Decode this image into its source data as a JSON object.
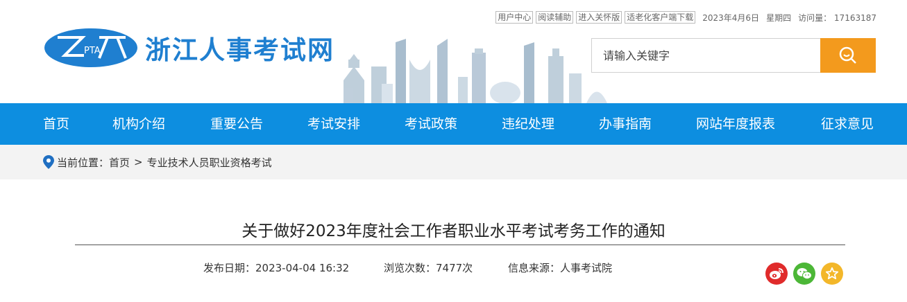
{
  "topbar": {
    "user_center": "用户中心",
    "reading_aid": "阅读辅助",
    "care_mode": "进入关怀版",
    "elderly_client": "适老化客户端下载",
    "date": "2023年4月6日",
    "weekday": "星期四",
    "visits_label": "访问量：",
    "visits_value": "17163187"
  },
  "logo": {
    "mark_text": "PTA",
    "site_name": "浙江人事考试网"
  },
  "search": {
    "placeholder": "请输入关键字"
  },
  "nav": {
    "items": [
      "首页",
      "机构介绍",
      "重要公告",
      "考试安排",
      "考试政策",
      "违纪处理",
      "办事指南",
      "网站年度报表",
      "征求意见"
    ]
  },
  "breadcrumb": {
    "label": "当前位置：",
    "home": "首页",
    "separator": ">",
    "current": "专业技术人员职业资格考试"
  },
  "article": {
    "title": "关于做好2023年度社会工作者职业水平考试考务工作的通知",
    "publish_date": "发布日期：2023-04-04 16:32",
    "views": "浏览次数：7477次",
    "source": "信息来源：人事考试院"
  },
  "share": {
    "icons": [
      "weibo-icon",
      "wechat-icon",
      "favorite-icon"
    ]
  },
  "colors": {
    "nav_bg": "#0d8ee0",
    "logo_blue": "#1f7fd0",
    "search_btn": "#f39a1d",
    "crumb_bg": "#f3f3f3",
    "weibo": "#e02b2b",
    "wechat": "#4cb737",
    "favorite": "#f3b72a"
  }
}
